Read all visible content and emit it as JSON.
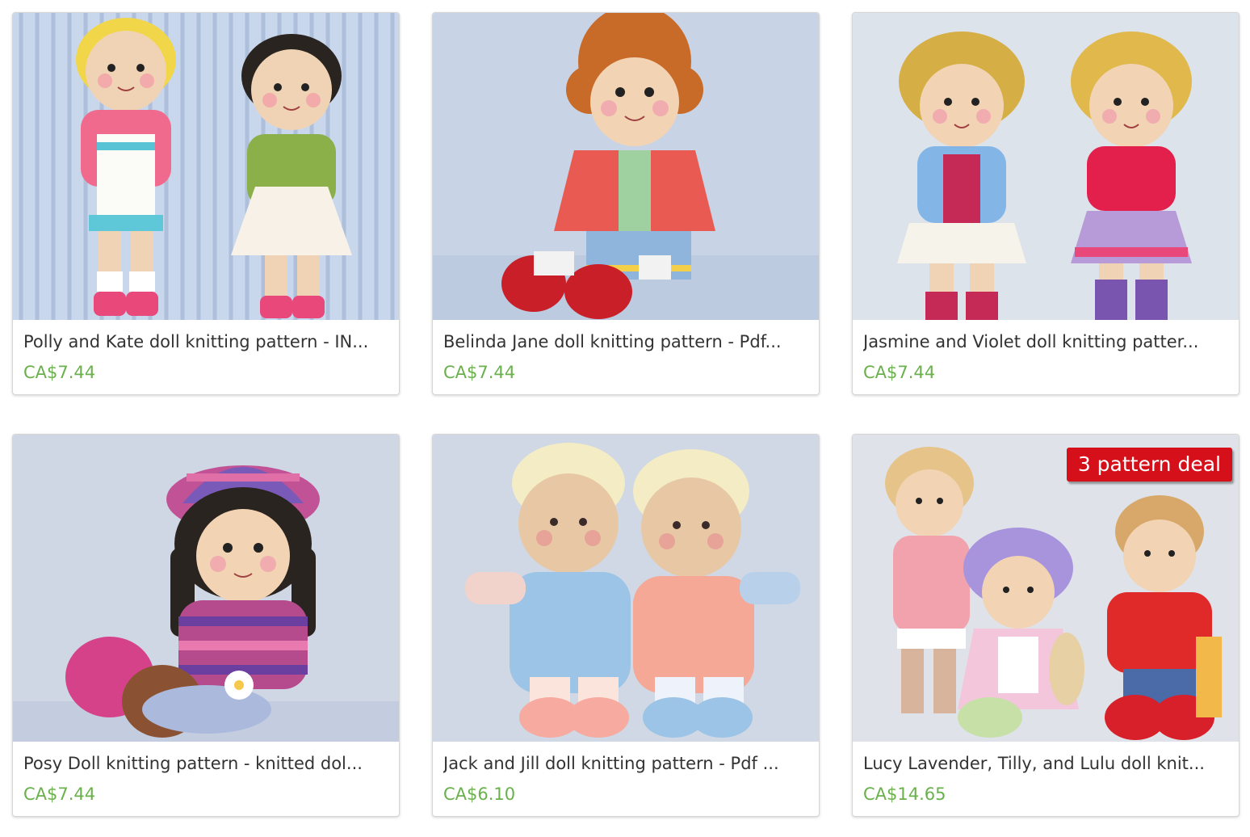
{
  "listings": [
    {
      "title": "Polly and Kate doll knitting pattern - IN...",
      "price": "CA$7.44"
    },
    {
      "title": "Belinda Jane doll knitting pattern - Pdf...",
      "price": "CA$7.44"
    },
    {
      "title": "Jasmine and Violet doll knitting patter...",
      "price": "CA$7.44"
    },
    {
      "title": "Posy Doll knitting pattern - knitted dol...",
      "price": "CA$7.44"
    },
    {
      "title": "Jack and Jill doll knitting pattern - Pdf ...",
      "price": "CA$6.10"
    },
    {
      "title": "Lucy Lavender, Tilly, and Lulu doll knit...",
      "price": "CA$14.65",
      "badge": "3 pattern deal"
    }
  ],
  "colors": {
    "price": "#6ab04c",
    "title": "#333333",
    "badge": "#d6101a"
  }
}
